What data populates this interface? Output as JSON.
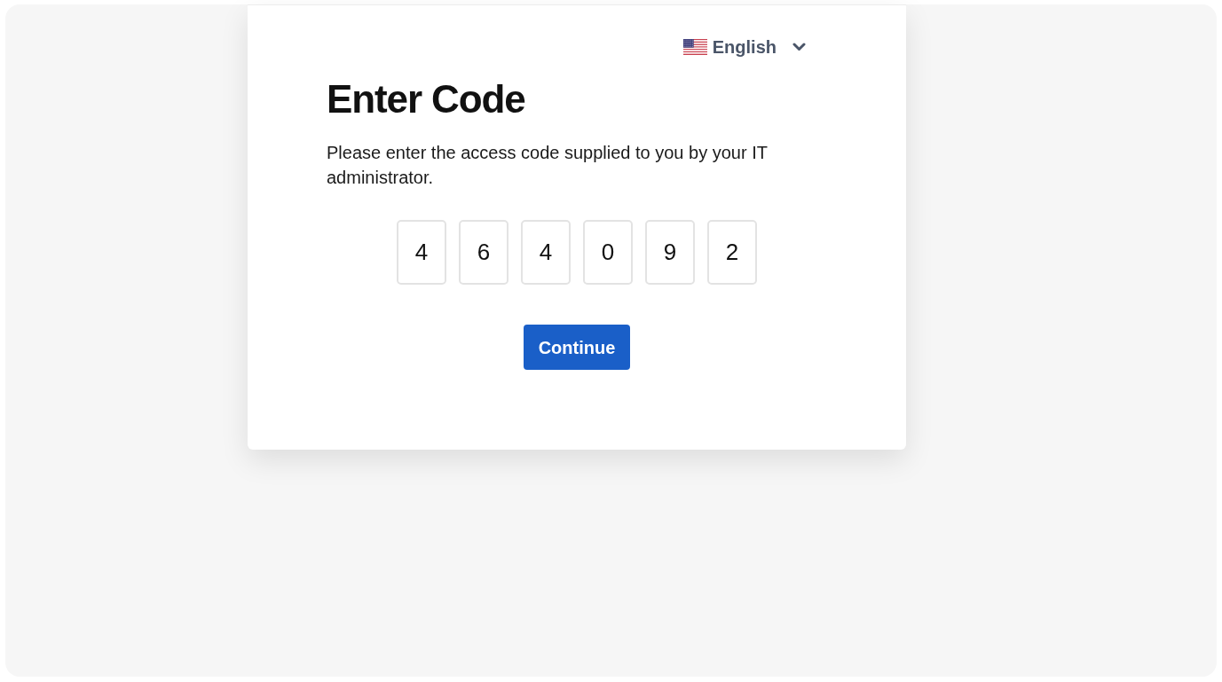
{
  "language_selector": {
    "label": "English"
  },
  "title": "Enter Code",
  "instructions": "Please enter the access code supplied to you by your IT administrator.",
  "code_digits": [
    "4",
    "6",
    "4",
    "0",
    "9",
    "2"
  ],
  "continue_button": {
    "label": "Continue"
  }
}
